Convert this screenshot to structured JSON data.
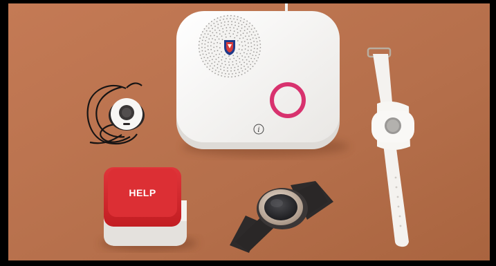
{
  "image": {
    "colors": {
      "background": "#b8724e",
      "frame": "#000000",
      "device_white": "#f6f5f3",
      "ring_pink": "#d8326e",
      "button_red": "#d1262a",
      "strap_dark": "#2a2727"
    },
    "objects": {
      "base_station": {
        "info_symbol": "i",
        "ring_icon": "ring-light-icon",
        "logo_icon": "shield-logo-icon"
      },
      "help_button": {
        "label": "HELP"
      },
      "pendant": {
        "icon": "pendant-button-icon"
      },
      "white_watch": {
        "icon": "wrist-button-icon"
      },
      "black_watch": {
        "icon": "smartwatch-face-icon"
      }
    }
  }
}
